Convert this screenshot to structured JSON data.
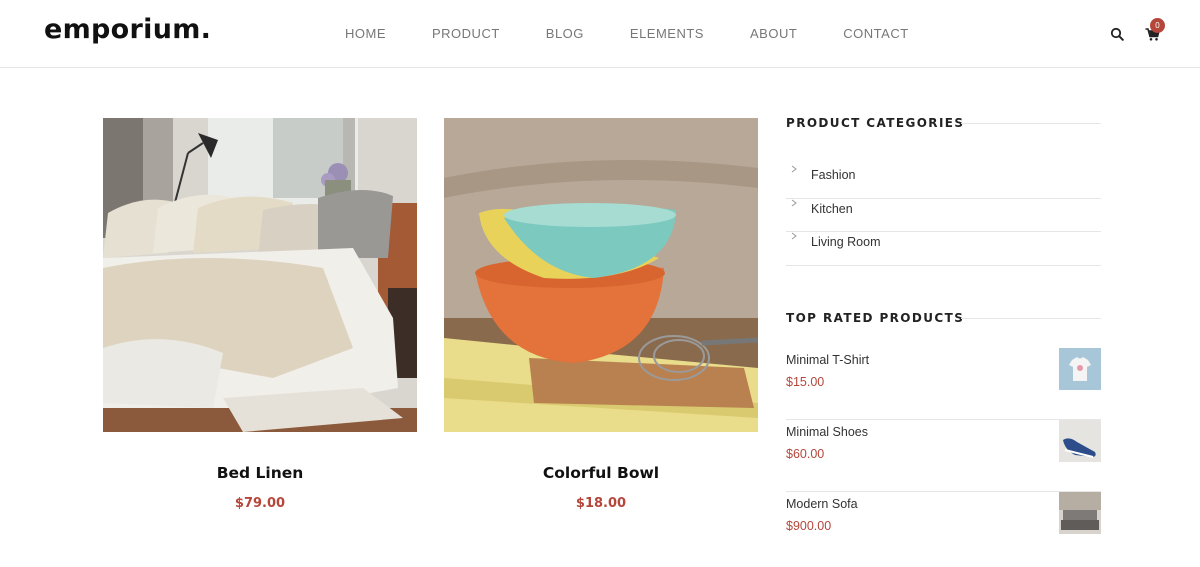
{
  "header": {
    "logo": "emporium.",
    "nav": [
      "HOME",
      "PRODUCT",
      "BLOG",
      "ELEMENTS",
      "ABOUT",
      "CONTACT"
    ],
    "cart_count": "0",
    "icons": [
      "search-icon",
      "cart-icon"
    ]
  },
  "products": [
    {
      "name": "Bed Linen",
      "price": "$79.00",
      "image": "bedroom-photo"
    },
    {
      "name": "Colorful Bowl",
      "price": "$18.00",
      "image": "bowls-photo"
    }
  ],
  "sidebar": {
    "categories_title": "PRODUCT CATEGORIES",
    "categories": [
      "Fashion",
      "Kitchen",
      "Living Room"
    ],
    "top_rated_title": "TOP RATED PRODUCTS",
    "top_rated": [
      {
        "name": "Minimal T-Shirt",
        "price": "$15.00",
        "thumb": "tshirt-thumbnail"
      },
      {
        "name": "Minimal Shoes",
        "price": "$60.00",
        "thumb": "shoes-thumbnail"
      },
      {
        "name": "Modern Sofa",
        "price": "$900.00",
        "thumb": "sofa-thumbnail"
      }
    ]
  },
  "colors": {
    "accent": "#b5463a",
    "text": "#222222",
    "nav_text": "#777777",
    "divider": "#e6e6e6"
  }
}
